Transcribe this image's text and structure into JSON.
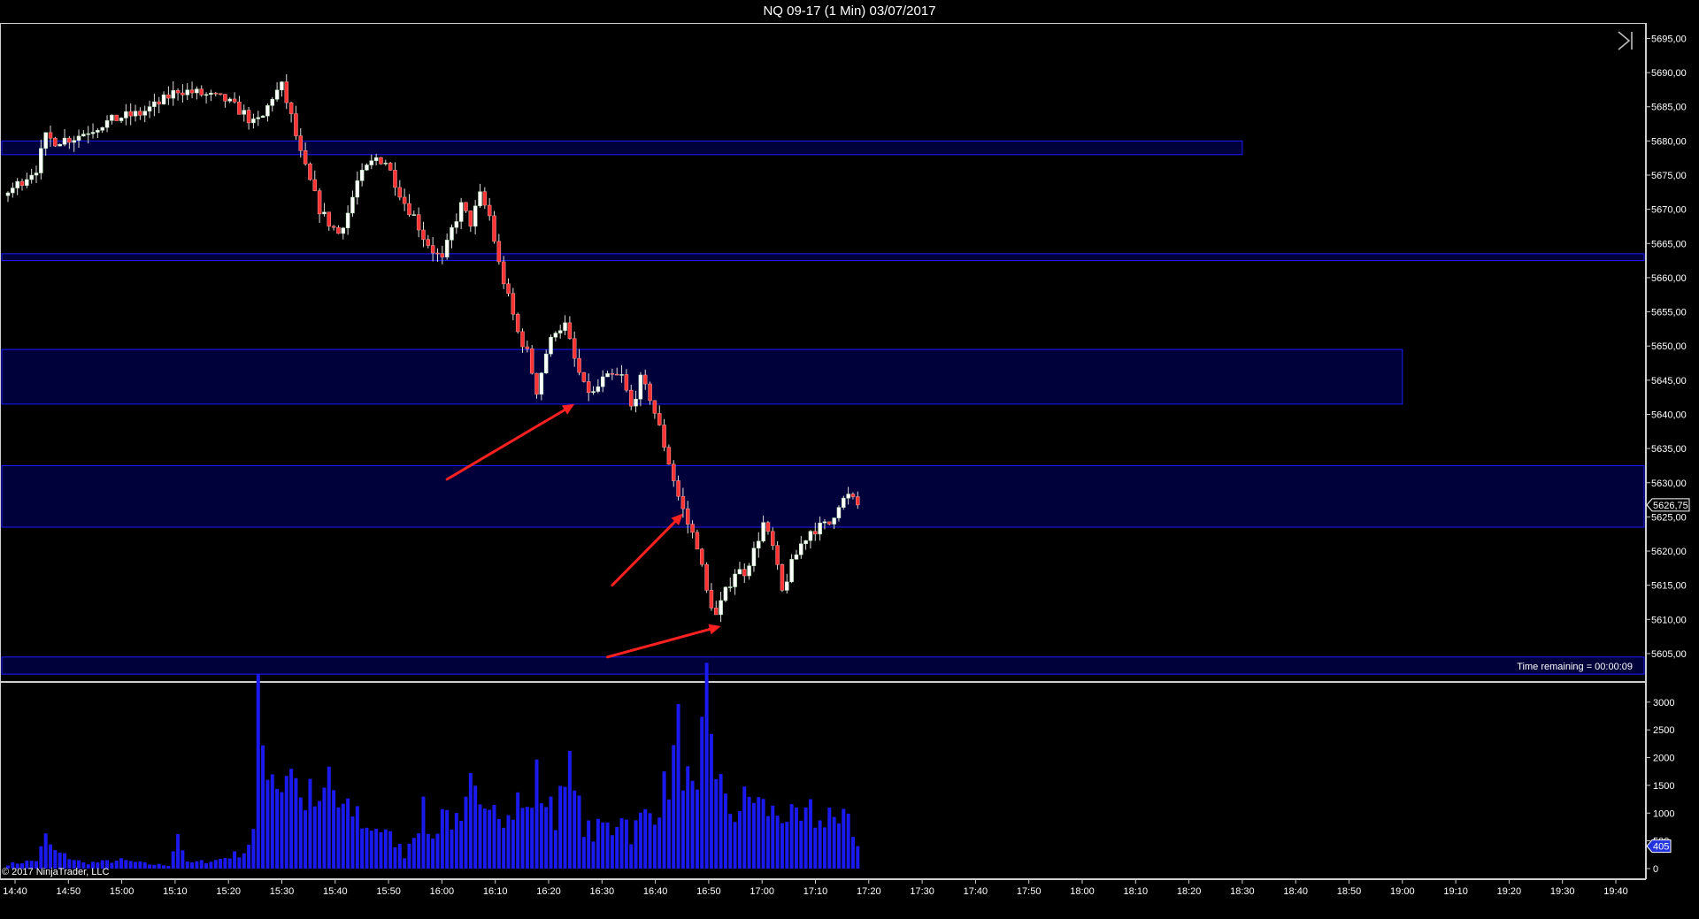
{
  "window": {
    "title": "NQ 09-17 (1 Min)  03/07/2017",
    "time_remaining": "Time remaining = 00:00:09",
    "copyright": "© 2017 NinjaTrader, LLC",
    "scroll_icon": "skip-to-end-icon"
  },
  "colors": {
    "background": "#000000",
    "up_candle": "#ffffff",
    "down_candle": "#ff3333",
    "zone_fill": "#00003a",
    "zone_border": "#1c1cff",
    "volume_bar": "#1a1aee",
    "arrow": "#ff2020"
  },
  "chart_data": [
    {
      "type": "candlestick",
      "x_ticks": [
        "14:40",
        "14:50",
        "15:00",
        "15:10",
        "15:20",
        "15:30",
        "15:40",
        "15:50",
        "16:00",
        "16:10",
        "16:20",
        "16:30",
        "16:40",
        "16:50",
        "17:00",
        "17:10",
        "17:20",
        "17:30",
        "17:40",
        "17:50",
        "18:00",
        "18:10",
        "18:20",
        "18:30",
        "18:40",
        "18:50",
        "19:00",
        "19:10",
        "19:20",
        "19:30",
        "19:40"
      ],
      "y_ticks": [
        "5695,00",
        "5690,00",
        "5685,00",
        "5680,00",
        "5675,00",
        "5670,00",
        "5665,00",
        "5660,00",
        "5655,00",
        "5650,00",
        "5645,00",
        "5640,00",
        "5635,00",
        "5630,00",
        "5625,00",
        "5620,00",
        "5615,00",
        "5610,00",
        "5605,00"
      ],
      "ylim": [
        5601.5,
        5697.0
      ],
      "last_price": "5626,75",
      "close_path": [
        [
          0,
          5672.5
        ],
        [
          6,
          5676
        ],
        [
          8,
          5680.5
        ],
        [
          10,
          5680
        ],
        [
          14,
          5680.5
        ],
        [
          20,
          5682.5
        ],
        [
          24,
          5683.5
        ],
        [
          28,
          5684
        ],
        [
          32,
          5685.5
        ],
        [
          36,
          5687.5
        ],
        [
          40,
          5687
        ],
        [
          46,
          5686
        ],
        [
          50,
          5684
        ],
        [
          52,
          5682.5
        ],
        [
          54,
          5683.5
        ],
        [
          56,
          5686.5
        ],
        [
          58,
          5688
        ],
        [
          60,
          5683.5
        ],
        [
          62,
          5678
        ],
        [
          64,
          5674
        ],
        [
          66,
          5670
        ],
        [
          68,
          5668
        ],
        [
          70,
          5666.5
        ],
        [
          72,
          5669.5
        ],
        [
          74,
          5674
        ],
        [
          76,
          5676
        ],
        [
          78,
          5677.5
        ],
        [
          80,
          5677
        ],
        [
          82,
          5674
        ],
        [
          84,
          5671
        ],
        [
          86,
          5669
        ],
        [
          88,
          5666
        ],
        [
          90,
          5664
        ],
        [
          92,
          5662.5
        ],
        [
          94,
          5667
        ],
        [
          96,
          5670.5
        ],
        [
          98,
          5668
        ],
        [
          100,
          5672
        ],
        [
          102,
          5669
        ],
        [
          104,
          5662
        ],
        [
          106,
          5657
        ],
        [
          108,
          5652
        ],
        [
          110,
          5649
        ],
        [
          112,
          5643.5
        ],
        [
          114,
          5649
        ],
        [
          116,
          5652.5
        ],
        [
          118,
          5653
        ],
        [
          120,
          5648
        ],
        [
          122,
          5644
        ],
        [
          124,
          5643
        ],
        [
          126,
          5645
        ],
        [
          128,
          5645.5
        ],
        [
          130,
          5645.5
        ],
        [
          132,
          5641
        ],
        [
          134,
          5645
        ],
        [
          136,
          5642.5
        ],
        [
          138,
          5638
        ],
        [
          140,
          5633
        ],
        [
          142,
          5628
        ],
        [
          144,
          5624
        ],
        [
          146,
          5621
        ],
        [
          148,
          5614
        ],
        [
          150,
          5610.5
        ],
        [
          152,
          5614
        ],
        [
          154,
          5617
        ],
        [
          156,
          5617
        ],
        [
          158,
          5620
        ],
        [
          160,
          5624
        ],
        [
          162,
          5620.5
        ],
        [
          164,
          5614
        ],
        [
          166,
          5618
        ],
        [
          168,
          5621
        ],
        [
          170,
          5623
        ],
        [
          172,
          5623.5
        ],
        [
          174,
          5624
        ],
        [
          176,
          5627
        ],
        [
          178,
          5628
        ],
        [
          180,
          5626.75
        ]
      ],
      "zones": [
        {
          "low": 5678.0,
          "high": 5680.0,
          "start_bar": 0,
          "end_bar": "18:30"
        },
        {
          "low": 5662.5,
          "high": 5663.5,
          "start_bar": 0,
          "end_bar": "right-edge"
        },
        {
          "low": 5641.5,
          "high": 5649.5,
          "start_bar": 0,
          "end_bar": "19:00"
        },
        {
          "low": 5623.5,
          "high": 5632.5,
          "start_bar": 0,
          "end_bar": "right-edge"
        },
        {
          "low": 5602.0,
          "high": 5604.5,
          "start_bar": 0,
          "end_bar": "right-edge"
        }
      ],
      "annotations": [
        {
          "type": "arrow",
          "from": [
            93,
            5630.5
          ],
          "to": [
            120,
            5641.5
          ]
        },
        {
          "type": "arrow",
          "from": [
            128,
            5615
          ],
          "to": [
            143,
            5625.5
          ]
        },
        {
          "type": "arrow",
          "from": [
            127,
            5604.5
          ],
          "to": [
            151,
            5609
          ]
        }
      ]
    },
    {
      "type": "bar",
      "name": "volume",
      "y_ticks": [
        "3000",
        "2500",
        "2000",
        "1500",
        "1000",
        "500",
        "0"
      ],
      "ylim": [
        0,
        3300
      ],
      "last_value": "405",
      "volume_path": [
        [
          0,
          80
        ],
        [
          6,
          150
        ],
        [
          8,
          550
        ],
        [
          10,
          300
        ],
        [
          16,
          100
        ],
        [
          20,
          120
        ],
        [
          24,
          150
        ],
        [
          30,
          80
        ],
        [
          34,
          60
        ],
        [
          36,
          650
        ],
        [
          38,
          100
        ],
        [
          44,
          150
        ],
        [
          46,
          200
        ],
        [
          48,
          250
        ],
        [
          50,
          300
        ],
        [
          52,
          650
        ],
        [
          53,
          2800
        ],
        [
          54,
          2200
        ],
        [
          56,
          1800
        ],
        [
          58,
          1500
        ],
        [
          60,
          2000
        ],
        [
          62,
          1200
        ],
        [
          64,
          1300
        ],
        [
          66,
          1000
        ],
        [
          68,
          1700
        ],
        [
          70,
          1100
        ],
        [
          72,
          1000
        ],
        [
          74,
          1000
        ],
        [
          76,
          700
        ],
        [
          78,
          800
        ],
        [
          80,
          600
        ],
        [
          82,
          500
        ],
        [
          84,
          250
        ],
        [
          86,
          700
        ],
        [
          88,
          1000
        ],
        [
          90,
          500
        ],
        [
          92,
          1100
        ],
        [
          94,
          900
        ],
        [
          96,
          700
        ],
        [
          98,
          1400
        ],
        [
          100,
          1000
        ],
        [
          102,
          1500
        ],
        [
          104,
          1200
        ],
        [
          106,
          900
        ],
        [
          108,
          1200
        ],
        [
          110,
          1000
        ],
        [
          112,
          1600
        ],
        [
          114,
          1200
        ],
        [
          116,
          900
        ],
        [
          118,
          2100
        ],
        [
          120,
          1300
        ],
        [
          122,
          800
        ],
        [
          124,
          600
        ],
        [
          126,
          800
        ],
        [
          128,
          700
        ],
        [
          130,
          1100
        ],
        [
          132,
          600
        ],
        [
          134,
          900
        ],
        [
          136,
          1000
        ],
        [
          138,
          1200
        ],
        [
          140,
          1600
        ],
        [
          142,
          2400
        ],
        [
          144,
          1500
        ],
        [
          146,
          1100
        ],
        [
          148,
          3200
        ],
        [
          150,
          1900
        ],
        [
          152,
          1100
        ],
        [
          154,
          1000
        ],
        [
          156,
          1200
        ],
        [
          158,
          1300
        ],
        [
          160,
          1100
        ],
        [
          162,
          1000
        ],
        [
          164,
          1000
        ],
        [
          166,
          900
        ],
        [
          168,
          800
        ],
        [
          170,
          1000
        ],
        [
          172,
          800
        ],
        [
          174,
          1100
        ],
        [
          176,
          700
        ],
        [
          178,
          1000
        ],
        [
          180,
          405
        ]
      ]
    }
  ]
}
